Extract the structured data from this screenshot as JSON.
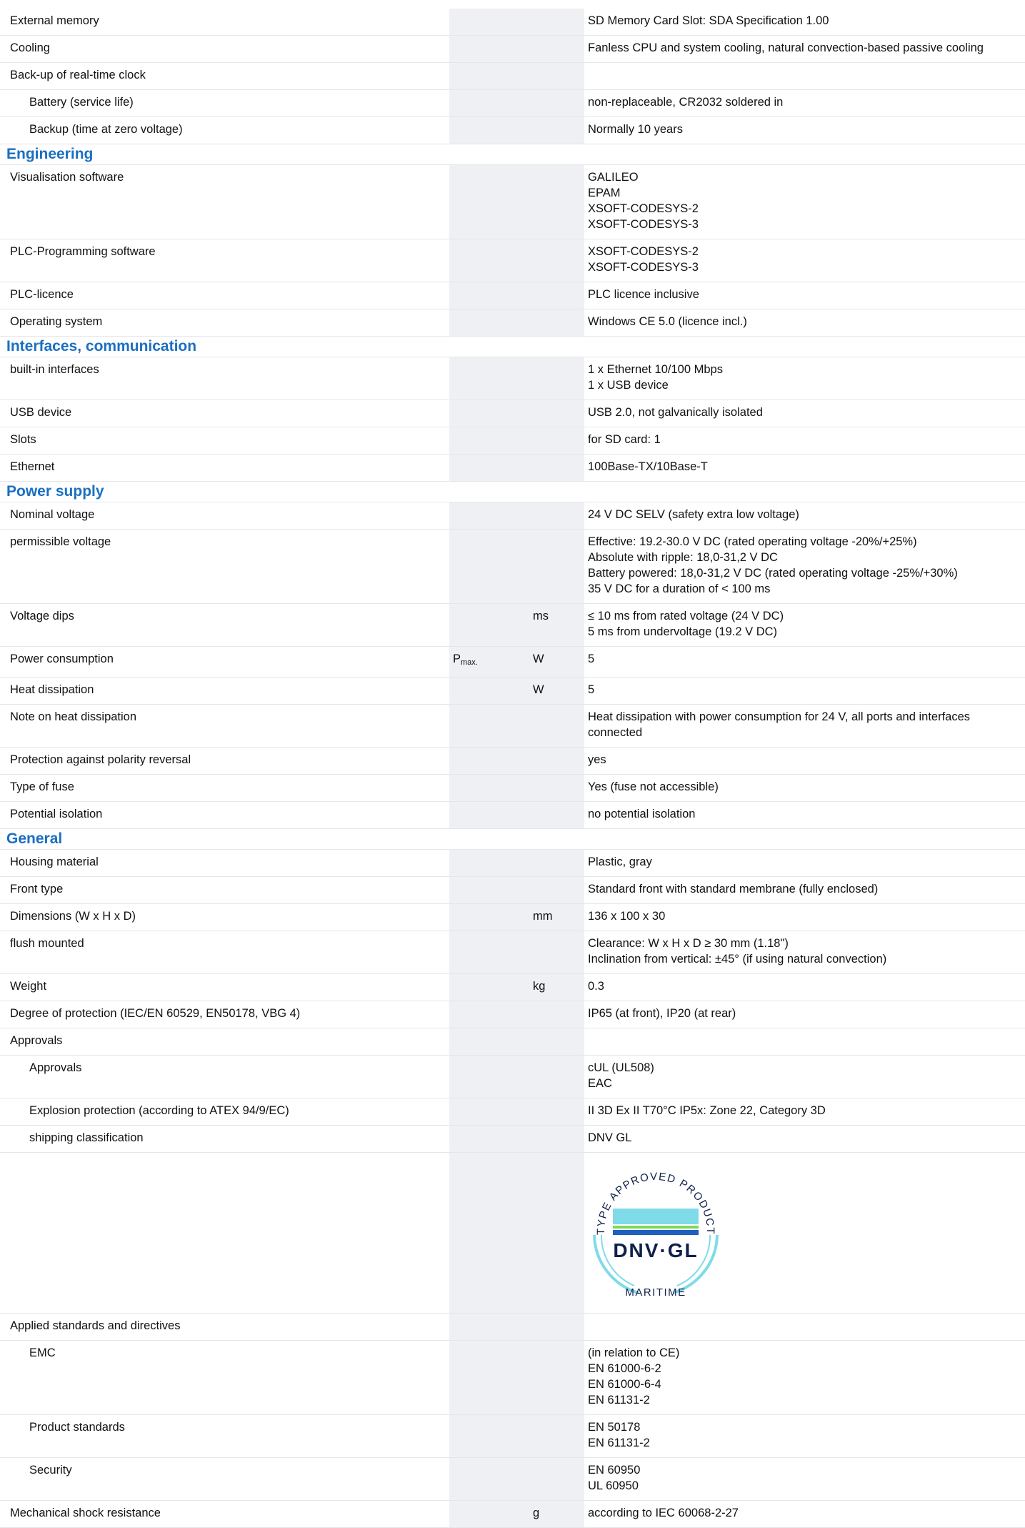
{
  "rows_top": [
    {
      "label": "External memory",
      "sym": "",
      "unit": "",
      "value": [
        "SD Memory Card Slot: SDA Specification 1.00"
      ],
      "indent": false
    },
    {
      "label": "Cooling",
      "sym": "",
      "unit": "",
      "value": [
        "Fanless CPU and system cooling, natural convection-based passive cooling"
      ],
      "indent": false
    },
    {
      "label": "Back-up of real-time clock",
      "sym": "",
      "unit": "",
      "value": [],
      "indent": false
    },
    {
      "label": "Battery (service life)",
      "sym": "",
      "unit": "",
      "value": [
        "non-replaceable, CR2032 soldered in"
      ],
      "indent": true
    },
    {
      "label": "Backup (time at zero voltage)",
      "sym": "",
      "unit": "",
      "value": [
        "Normally 10 years"
      ],
      "indent": true
    }
  ],
  "sections": {
    "engineering": "Engineering",
    "interfaces": "Interfaces, communication",
    "power": "Power supply",
    "general": "General"
  },
  "rows_engineering": [
    {
      "label": "Visualisation software",
      "sym": "",
      "unit": "",
      "value": [
        "GALILEO",
        "EPAM",
        "XSOFT-CODESYS-2",
        "XSOFT-CODESYS-3"
      ],
      "indent": false
    },
    {
      "label": "PLC-Programming software",
      "sym": "",
      "unit": "",
      "value": [
        "XSOFT-CODESYS-2",
        "XSOFT-CODESYS-3"
      ],
      "indent": false
    },
    {
      "label": "PLC-licence",
      "sym": "",
      "unit": "",
      "value": [
        "PLC licence inclusive"
      ],
      "indent": false
    },
    {
      "label": "Operating system",
      "sym": "",
      "unit": "",
      "value": [
        "Windows CE 5.0 (licence incl.)"
      ],
      "indent": false
    }
  ],
  "rows_interfaces": [
    {
      "label": "built-in interfaces",
      "sym": "",
      "unit": "",
      "value": [
        "1 x Ethernet 10/100 Mbps",
        "1 x USB device"
      ],
      "indent": false
    },
    {
      "label": "USB device",
      "sym": "",
      "unit": "",
      "value": [
        "USB 2.0, not galvanically isolated"
      ],
      "indent": false
    },
    {
      "label": "Slots",
      "sym": "",
      "unit": "",
      "value": [
        "for SD card: 1"
      ],
      "indent": false
    },
    {
      "label": "Ethernet",
      "sym": "",
      "unit": "",
      "value": [
        "100Base-TX/10Base-T"
      ],
      "indent": false
    }
  ],
  "rows_power": [
    {
      "label": "Nominal voltage",
      "sym": "",
      "unit": "",
      "value": [
        "24 V DC SELV (safety extra low voltage)"
      ],
      "indent": false
    },
    {
      "label": "permissible voltage",
      "sym": "",
      "unit": "",
      "value": [
        "Effective: 19.2-30.0 V DC (rated operating voltage -20%/+25%)",
        "Absolute with ripple: 18,0-31,2 V DC",
        "Battery powered: 18,0-31,2 V DC (rated operating voltage -25%/+30%)",
        "35 V DC for a duration of < 100 ms"
      ],
      "indent": false
    },
    {
      "label": "Voltage dips",
      "sym": "",
      "unit": "ms",
      "value": [
        "≤ 10 ms from rated voltage (24 V DC)",
        "5 ms from undervoltage (19.2 V DC)"
      ],
      "indent": false
    },
    {
      "label": "Power consumption",
      "sym": "P",
      "sym_sub": "max.",
      "unit": "W",
      "value": [
        "5"
      ],
      "indent": false
    },
    {
      "label": "Heat dissipation",
      "sym": "",
      "unit": "W",
      "value": [
        "5"
      ],
      "indent": false
    },
    {
      "label": "Note on heat dissipation",
      "sym": "",
      "unit": "",
      "value": [
        "Heat dissipation with power consumption for 24 V, all ports and interfaces",
        "connected"
      ],
      "indent": false
    },
    {
      "label": "Protection against polarity reversal",
      "sym": "",
      "unit": "",
      "value": [
        "yes"
      ],
      "indent": false
    },
    {
      "label": "Type of fuse",
      "sym": "",
      "unit": "",
      "value": [
        "Yes (fuse not accessible)"
      ],
      "indent": false
    },
    {
      "label": "Potential isolation",
      "sym": "",
      "unit": "",
      "value": [
        "no potential isolation"
      ],
      "indent": false
    }
  ],
  "rows_general": [
    {
      "label": "Housing material",
      "sym": "",
      "unit": "",
      "value": [
        "Plastic, gray"
      ],
      "indent": false
    },
    {
      "label": "Front type",
      "sym": "",
      "unit": "",
      "value": [
        "Standard front with standard membrane (fully enclosed)"
      ],
      "indent": false
    },
    {
      "label": "Dimensions (W x H x D)",
      "sym": "",
      "unit": "mm",
      "value": [
        "136 x 100 x 30"
      ],
      "indent": false
    },
    {
      "label": "flush mounted",
      "sym": "",
      "unit": "",
      "value": [
        "Clearance: W x H x D ≥ 30 mm (1.18\")",
        "Inclination from vertical: ±45° (if using natural convection)"
      ],
      "indent": false
    },
    {
      "label": "Weight",
      "sym": "",
      "unit": "kg",
      "value": [
        "0.3"
      ],
      "indent": false
    },
    {
      "label": "Degree of protection (IEC/EN 60529, EN50178, VBG 4)",
      "sym": "",
      "unit": "",
      "value": [
        "IP65 (at front), IP20 (at rear)"
      ],
      "indent": false
    },
    {
      "label": "Approvals",
      "sym": "",
      "unit": "",
      "value": [],
      "indent": false
    },
    {
      "label": "Approvals",
      "sym": "",
      "unit": "",
      "value": [
        "cUL (UL508)",
        "EAC"
      ],
      "indent": true
    },
    {
      "label": "Explosion protection (according to ATEX 94/9/EC)",
      "sym": "",
      "unit": "",
      "value": [
        "II 3D Ex II T70°C IP5x: Zone 22, Category 3D"
      ],
      "indent": true
    },
    {
      "label": "shipping classification",
      "sym": "",
      "unit": "",
      "value": [
        "DNV GL"
      ],
      "indent": true
    }
  ],
  "logo": {
    "arc_text": "TYPE APPROVED PRODUCT",
    "brand": "DNV·GL",
    "sub": "MARITIME",
    "colors": {
      "cyan": "#7fdbe8",
      "green": "#7ed957",
      "blue": "#1f5fbf",
      "navy": "#0f204b"
    }
  },
  "rows_bottom": [
    {
      "label": "Applied standards and directives",
      "sym": "",
      "unit": "",
      "value": [],
      "indent": false
    },
    {
      "label": "EMC",
      "sym": "",
      "unit": "",
      "value": [
        "(in relation to CE)",
        "EN 61000-6-2",
        "EN 61000-6-4",
        "EN 61131-2"
      ],
      "indent": true
    },
    {
      "label": "Product standards",
      "sym": "",
      "unit": "",
      "value": [
        "EN 50178",
        "EN 61131-2"
      ],
      "indent": true
    },
    {
      "label": "Security",
      "sym": "",
      "unit": "",
      "value": [
        "EN 60950",
        "UL 60950"
      ],
      "indent": true
    },
    {
      "label": "Mechanical shock resistance",
      "sym": "",
      "unit": "g",
      "value": [
        "according to IEC 60068-2-27"
      ],
      "indent": false
    }
  ]
}
